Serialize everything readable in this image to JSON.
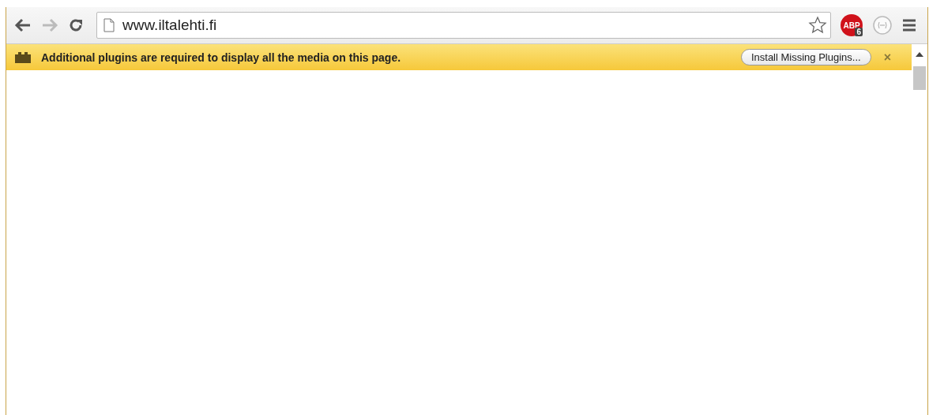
{
  "toolbar": {
    "back": {
      "disabled": false
    },
    "forward": {
      "disabled": true
    },
    "address": "www.iltalehti.fi",
    "bookmarked": false,
    "extension": {
      "label": "ABP",
      "badge": "6"
    }
  },
  "infobar": {
    "message": "Additional plugins are required to display all the media on this page.",
    "button": "Install Missing Plugins...",
    "close": "×"
  }
}
